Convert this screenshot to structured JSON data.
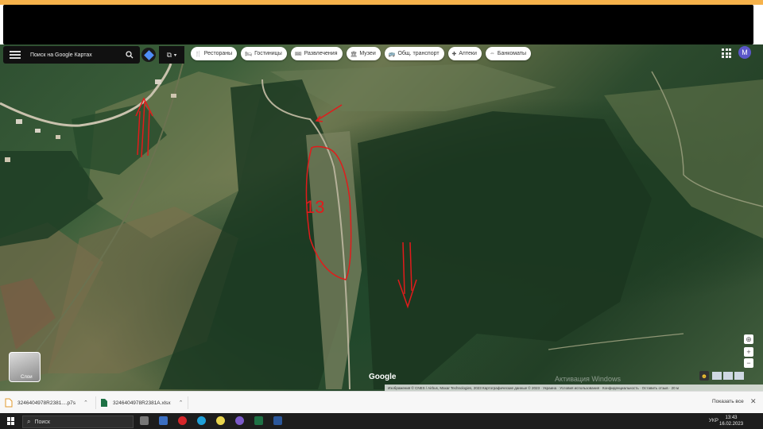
{
  "search": {
    "text": "Поиск на Google Картах"
  },
  "filters": [
    {
      "icon": "fork-knife-icon",
      "glyph": "🍴",
      "label": "Рестораны"
    },
    {
      "icon": "bed-icon",
      "glyph": "🛏",
      "label": "Гостиницы"
    },
    {
      "icon": "ticket-icon",
      "glyph": "🎟",
      "label": "Развлечения"
    },
    {
      "icon": "museum-icon",
      "glyph": "🏛",
      "label": "Музеи"
    },
    {
      "icon": "bus-icon",
      "glyph": "🚌",
      "label": "Общ. транспорт"
    },
    {
      "icon": "pharmacy-icon",
      "glyph": "✚",
      "label": "Аптеки"
    },
    {
      "icon": "atm-icon",
      "glyph": "⇔",
      "label": "Банкоматы"
    }
  ],
  "account": {
    "initial": "M",
    "color": "#5b57c9"
  },
  "annotations": {
    "pond_number": "13"
  },
  "map": {
    "layers_label": "Слои",
    "google_logo": "Google",
    "watermark": "Активация Windows",
    "footer": "Изображения © CNES / Airbus, Maxar Technologies, 2023 Картографические данные © 2023 · Украина · Условия использования · Конфиденциальность · Оставить отзыв · 20 м"
  },
  "downloads": {
    "items": [
      {
        "name": "3246404978R2381....p7s"
      },
      {
        "name": "3246404978R2381A.xlsx"
      }
    ],
    "show_all": "Показать все"
  },
  "taskbar": {
    "search_placeholder": "Поиск",
    "lang": "УКР",
    "time": "13:43",
    "date": "16.02.2023"
  },
  "colors": {
    "annotation": "#e21b1b",
    "topbar": "#f6b24a"
  }
}
